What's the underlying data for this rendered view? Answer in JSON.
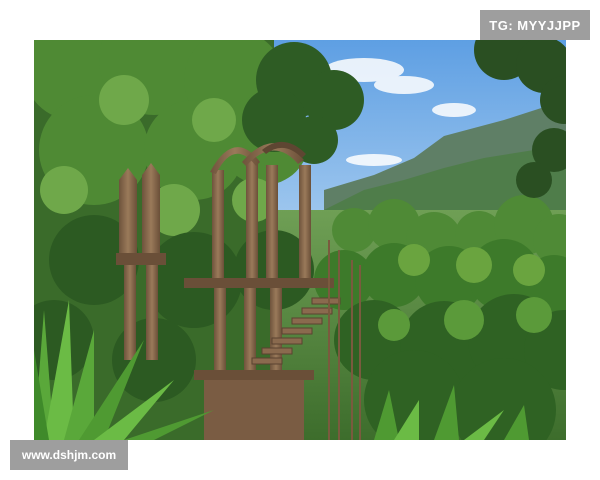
{
  "watermarks": {
    "top_right": "TG: MYYJJPP",
    "bottom_left": "www.dshjm.com"
  },
  "photo": {
    "subject": "stone-arches-and-stairs-in-jungle",
    "colors": {
      "sky": "#79b3ec",
      "foliage_dark": "#2f5f25",
      "foliage_mid": "#4e8a32",
      "foliage_light": "#8fbf52",
      "stone": "#8a6a4e",
      "mountain": "#5f7f66"
    }
  }
}
